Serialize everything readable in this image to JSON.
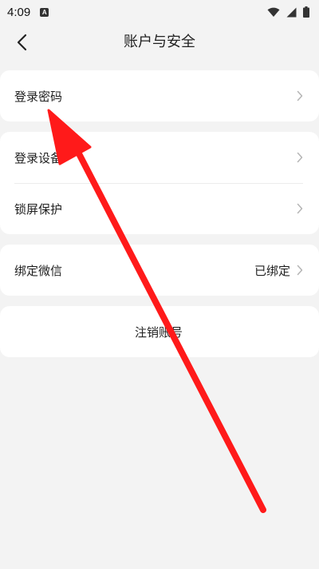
{
  "status_bar": {
    "time": "4:09",
    "notification_icon": "a-notification-icon"
  },
  "nav": {
    "back_icon": "chevron-left-icon",
    "title": "账户与安全"
  },
  "sections": {
    "password": {
      "label": "登录密码"
    },
    "devices": {
      "label": "登录设备"
    },
    "screen_lock": {
      "label": "锁屏保护"
    },
    "wechat": {
      "label": "绑定微信",
      "value": "已绑定"
    },
    "delete_account": {
      "label": "注销账号"
    }
  },
  "annotation": {
    "color": "#ff1a1a"
  }
}
